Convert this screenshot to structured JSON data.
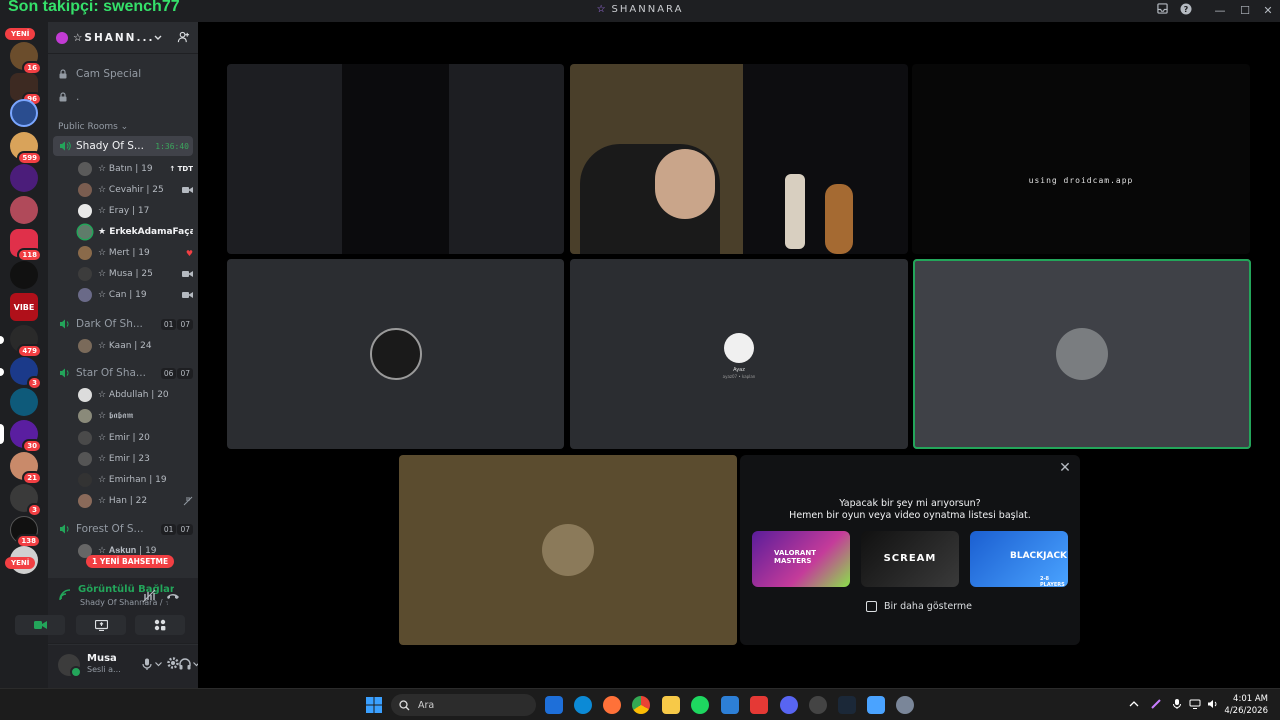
{
  "overlay": {
    "follower_text": "Son takipçi: swench77"
  },
  "window": {
    "title": "SHANNARA",
    "title_star": "☆"
  },
  "rail": {
    "new_top": "YENİ",
    "new_bottom": "YENİ",
    "badges": [
      "16",
      "96",
      "599",
      "118",
      "479",
      "3",
      "30",
      "21",
      "3",
      "138"
    ],
    "vibe_label": "VIBE"
  },
  "guild": {
    "name": "☆SHANN..."
  },
  "channels": [
    {
      "name": "Cam Special"
    },
    {
      "name": "."
    }
  ],
  "category": {
    "label": "Public Rooms ⌄"
  },
  "voice_channels": [
    {
      "name": "Shady Of S...",
      "timer": "1:36:40",
      "members": [
        {
          "name": "☆ Batın | 19",
          "tag": "TDT",
          "color": "#5a5a5a"
        },
        {
          "name": "☆ Cevahir | 25",
          "color": "#7a5d50"
        },
        {
          "name": "☆ Eray | 17",
          "color": "#e9e9e9"
        },
        {
          "name": "★ ErkekAdamaFaça...",
          "color": "#5f7c6a"
        },
        {
          "name": "☆ Mert | 19",
          "color": "#8a6a4a"
        },
        {
          "name": "☆ Musa | 25",
          "color": "#3c3c3c"
        },
        {
          "name": "☆ Can | 19",
          "color": "#6a6a88"
        }
      ]
    },
    {
      "name": "Dark Of Sh...",
      "count_a": "01",
      "count_b": "07",
      "members": [
        {
          "name": "☆ Kaan | 24",
          "color": "#7a6a5a"
        }
      ]
    },
    {
      "name": "Star Of Sha...",
      "count_a": "06",
      "count_b": "07",
      "members": [
        {
          "name": "☆ Abdullah | 20",
          "color": "#dcdcdc"
        },
        {
          "name": "☆ 𝖇𝖆𝖇𝖆𝖒",
          "color": "#8a8a7a"
        },
        {
          "name": "☆ Emir | 20",
          "color": "#4a4a4a"
        },
        {
          "name": "☆ Emir | 23",
          "color": "#555"
        },
        {
          "name": "☆ Emirhan | 19",
          "color": "#333"
        },
        {
          "name": "☆ Han | 22",
          "color": "#8a6a5a"
        }
      ]
    },
    {
      "name": "Forest Of S...",
      "count_a": "01",
      "count_b": "07",
      "members": [
        {
          "name": "☆ 𝐀𝐬𝐤𝐮𝐧 | 19",
          "color": "#666"
        }
      ]
    }
  ],
  "new_mentions": "1 YENİ BAHSETME",
  "voice_panel": {
    "status": "Görüntülü Bağlantı Kuruldu",
    "sub": "Shady Of Shannara / ☆ S..."
  },
  "user": {
    "name": "Musa",
    "status": "Sesli a..."
  },
  "stage": {
    "droidcam_text": "using droidcam.app",
    "avatar_caption": "Ayaz",
    "avatar_caption_sub": "ayaz07 • kaplan"
  },
  "activity": {
    "question": "Yapacak bir şey mi arıyorsun?",
    "subtitle": "Hemen bir oyun veya video oynatma listesi başlat.",
    "games": [
      {
        "name": "VALORANT MASTERS",
        "color": "#7d2fc4"
      },
      {
        "name": "SCREAM",
        "color": "#1a1a1a"
      },
      {
        "name": "BLACKJACK",
        "color": "#2b7de9",
        "sub": "2-8 PLAYERS"
      }
    ],
    "dont_show": "Bir daha gösterme"
  },
  "taskbar": {
    "search_placeholder": "Ara",
    "time": "4:01 AM",
    "date": "4/26/2026"
  },
  "colors": {
    "accent_green": "#23a55a",
    "danger_red": "#f23f43",
    "sidebar_bg": "#2b2d31",
    "rail_bg": "#1e1f22"
  }
}
